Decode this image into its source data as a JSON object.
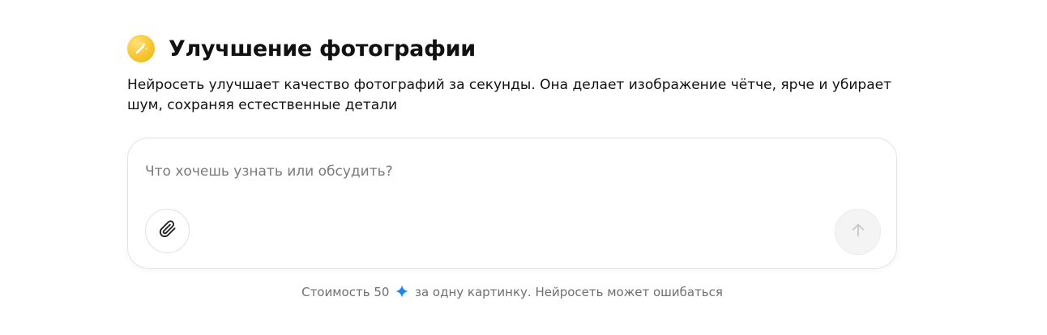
{
  "header": {
    "title": "Улучшение фотографии",
    "icon": "magic-wand-icon",
    "icon_color": "#F7C52F"
  },
  "description": "Нейросеть улучшает качество фотографий за секунды. Она делает изображение чётче, ярче и убирает шум, сохраняя естественные детали",
  "composer": {
    "placeholder": "Что хочешь узнать или обсудить?",
    "value": "",
    "attach_icon": "paperclip-icon",
    "send_icon": "arrow-up-icon",
    "send_enabled": false
  },
  "footer": {
    "cost_prefix": "Стоимость 50",
    "cost_icon": "sparkle-icon",
    "cost_icon_color": "#1E88E5",
    "cost_suffix": "за одну картинку. Нейросеть может ошибаться"
  }
}
